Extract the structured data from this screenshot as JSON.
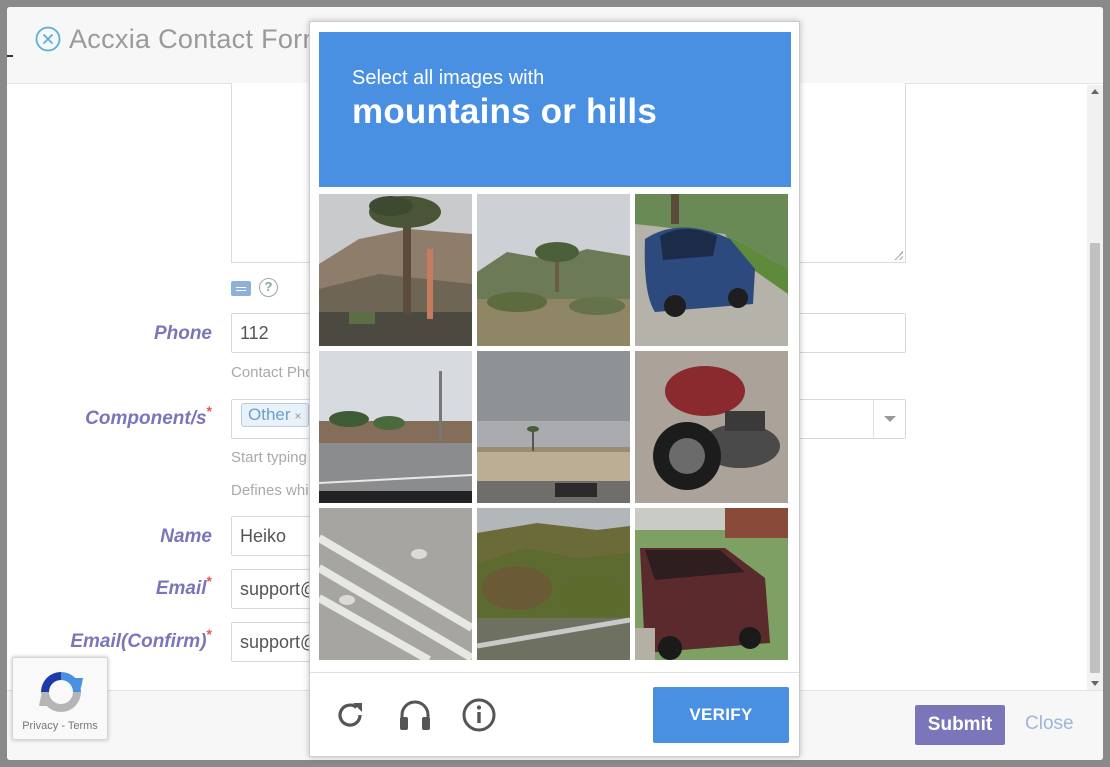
{
  "modal": {
    "title": "Accxia Contact Form",
    "fields": {
      "phone_label": "Phone",
      "phone_value": "112",
      "phone_hint": "Contact Phone",
      "component_label": "Component/s",
      "component_tag": "Other",
      "component_hint1": "Start typing",
      "component_hint2": "Defines which",
      "name_label": "Name",
      "name_value": "Heiko",
      "email_label": "Email",
      "email_value": "support@",
      "email_confirm_label": "Email(Confirm)",
      "email_confirm_value": "support@",
      "required_mark": "*"
    },
    "footer": {
      "submit_label": "Submit",
      "close_label": "Close"
    }
  },
  "recaptcha_badge": {
    "links": "Privacy - Terms"
  },
  "captcha": {
    "instruction": "Select all images with",
    "target": "mountains or hills",
    "tiles": [
      "palm-tree-hill",
      "palm-desert-hills",
      "blue-car",
      "roadside-palms",
      "low-building-palms",
      "red-motorcycle",
      "crosswalk-lines",
      "green-hillside",
      "red-suv"
    ],
    "verify_label": "VERIFY"
  },
  "colors": {
    "captcha_blue": "#4a90e2",
    "accent_purple": "#7b76ba"
  }
}
